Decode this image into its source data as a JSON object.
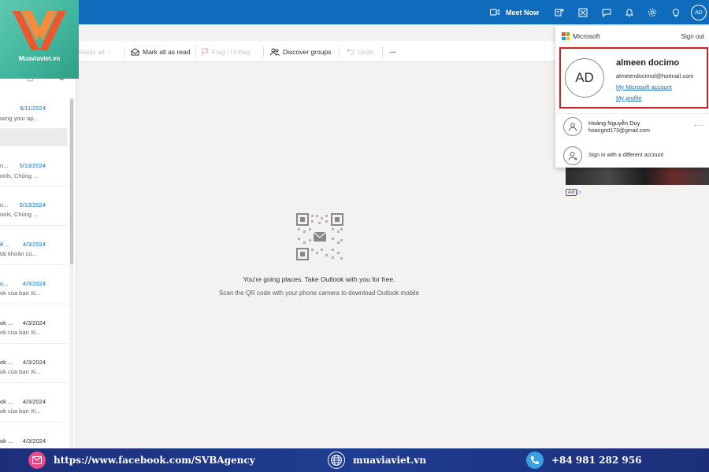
{
  "brand": {
    "logo_text": "Muaviaviet.vn"
  },
  "header": {
    "meet_now_label": "Meet Now",
    "avatar_initials": "AD"
  },
  "toolbar": {
    "reply_all_label": "Reply all",
    "mark_all_read_label": "Mark all as read",
    "flag_label": "Flag / Unflag",
    "discover_groups_label": "Discover groups",
    "undo_label": "Undo",
    "more_label": "···"
  },
  "mail_list": {
    "items": [
      {
        "sender": "",
        "date": "6/11/2024",
        "preview": "wing your ap..."
      },
      {
        "sender": "n...",
        "date": "5/13/2024",
        "preview": "ools, Chúng ..."
      },
      {
        "sender": "n...",
        "date": "5/13/2024",
        "preview": "ools, Chúng ..."
      },
      {
        "sender": "ể ...",
        "date": "4/3/2024",
        "preview": "tài khoản củ..."
      },
      {
        "sender": "o...",
        "date": "4/3/2024",
        "preview": "ok của bạn Xi..."
      },
      {
        "sender": "ok ...",
        "date": "4/3/2024",
        "preview": "ok của bạn Xi..."
      },
      {
        "sender": "ok ...",
        "date": "4/3/2024",
        "preview": "ok của bạn Xi..."
      },
      {
        "sender": "ok ...",
        "date": "4/3/2024",
        "preview": "ok của bạn Xi..."
      },
      {
        "sender": "ok ...",
        "date": "4/3/2024",
        "preview": ""
      }
    ]
  },
  "promo": {
    "title": "You're going places. Take Outlook with you for free.",
    "subtitle": "Scan the QR code with your phone camera to download Outlook mobile"
  },
  "ad": {
    "badge": "Ad"
  },
  "account_panel": {
    "brand": "Microsoft",
    "sign_out": "Sign out",
    "initials": "AD",
    "name": "almeen docimo",
    "email": "almeendocimol@hotmail.com",
    "ms_account_link": "My Microsoft account",
    "profile_link": "My profile",
    "other_account": {
      "name": "Hoàng Nguyễn Duy",
      "email": "hoangnd173@gmail.com"
    },
    "more": "···",
    "sign_in_different": "Sign in with a different account"
  },
  "footer": {
    "facebook": "https://www.facebook.com/SVBAgency",
    "website": "muaviaviet.vn",
    "phone": "+84 981 282 956"
  },
  "colors": {
    "header_blue": "#0f6cbd",
    "highlight_red": "#d21f1f",
    "footer_navy": "#1d2f7a",
    "logo_teal": "#3fb49a",
    "logo_orange": "#f0562a"
  }
}
